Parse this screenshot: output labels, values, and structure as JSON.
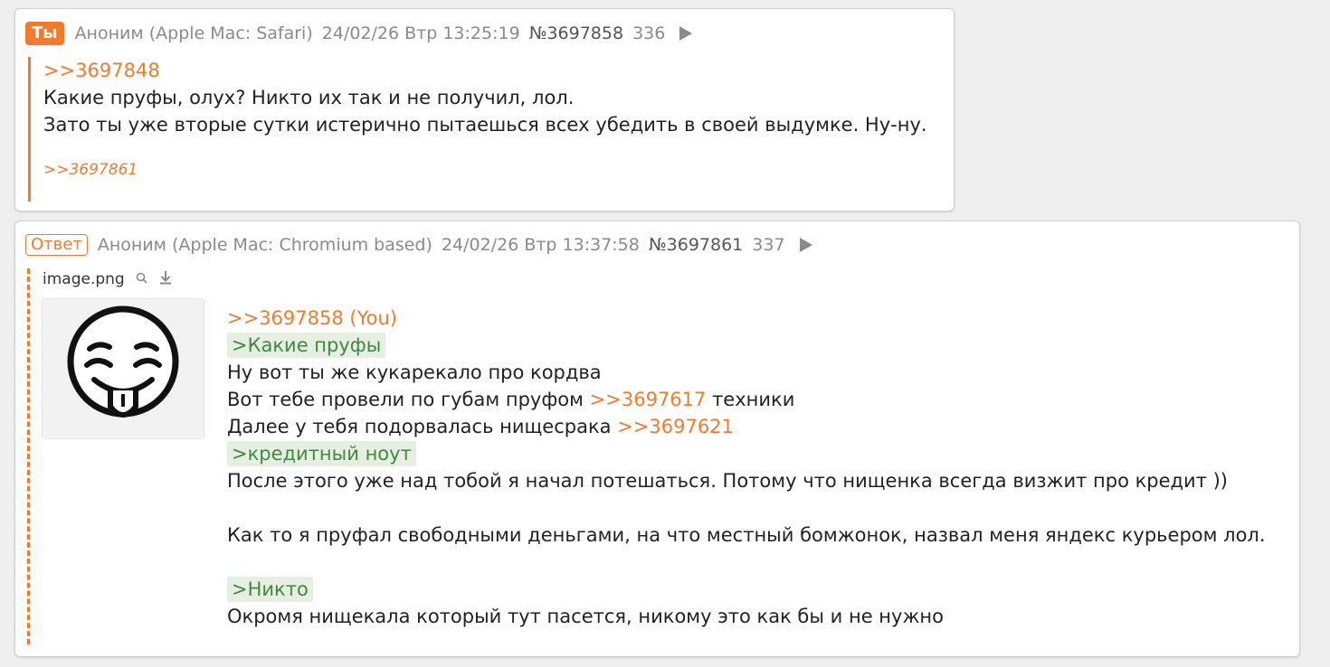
{
  "post1": {
    "badge": "Ты",
    "author": "Аноним (Apple Mac: Safari)",
    "date": "24/02/26 Втр 13:25:19",
    "number": "№3697858",
    "count": "336",
    "body": {
      "reply_ref": ">>3697848",
      "line1": "Какие пруфы, олух? Никто их так и не получил, лол.",
      "line2": "Зато ты уже вторые сутки истерично пытаешься всех убедить в своей выдумке. Ну-ну."
    },
    "backlink": ">>3697861"
  },
  "post2": {
    "badge": "Ответ",
    "author": "Аноним (Apple Mac: Chromium based)",
    "date": "24/02/26 Втр 13:37:58",
    "number": "№3697861",
    "count": "337",
    "file": {
      "name": "image.png",
      "search_icon": "magnifier-icon",
      "download_icon": "download-icon"
    },
    "body": {
      "reply_ref": ">>3697858 (You)",
      "quote1": ">Какие пруфы",
      "line1": "Ну вот ты же кукарекало про кордва",
      "line2_pre": "Вот тебе провели по губам пруфом ",
      "line2_link": ">>3697617",
      "line2_post": " техники",
      "line3_pre": "Далее у тебя подорвалась нищесрака ",
      "line3_link": ">>3697621",
      "quote2": ">кредитный ноут",
      "line4": "После этого уже над тобой я начал потешаться. Потому что нищенка всегда визжит про кредит ))",
      "line5": "Как то я пруфал свободными деньгами, на что местный бомжонок, назвал меня яндекс курьером лол.",
      "quote3": ">Никто",
      "line6": "Окромя нищекала который тут пасется, никому это как бы и не нужно"
    }
  },
  "colors": {
    "accent": "#f07b2e",
    "quote_text": "#3f8a3f",
    "quote_bg": "#e6efe2"
  }
}
